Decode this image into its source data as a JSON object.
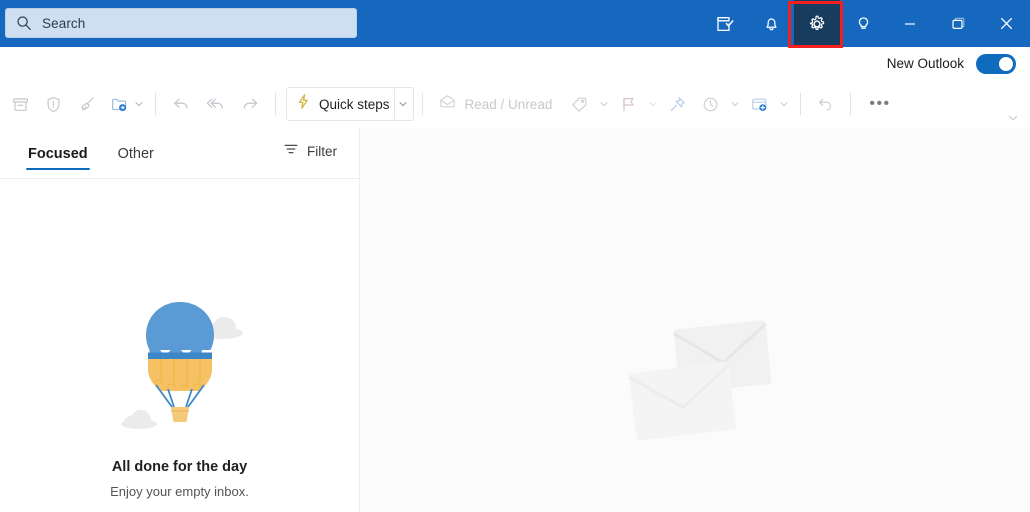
{
  "titlebar": {
    "search": {
      "placeholder": "Search",
      "value": "",
      "icon": "search-icon"
    },
    "buttons": [
      {
        "name": "task-compose-icon",
        "title": "New note"
      },
      {
        "name": "notifications-bell-icon",
        "title": "Notifications"
      },
      {
        "name": "settings-gear-icon",
        "title": "Settings",
        "highlighted": true
      },
      {
        "name": "tips-lightbulb-icon",
        "title": "Tips"
      }
    ],
    "window_controls": [
      {
        "name": "minimize-icon",
        "title": "Minimize"
      },
      {
        "name": "restore-icon",
        "title": "Restore"
      },
      {
        "name": "close-icon",
        "title": "Close"
      }
    ],
    "colors": {
      "background": "#1568bd",
      "search_background": "#cddff0",
      "highlight_border": "#f42020",
      "gear_active_background": "#173c5e"
    }
  },
  "new_outlook": {
    "label": "New Outlook",
    "toggle_on": true,
    "accent": "#0f6cbd"
  },
  "ribbon": {
    "items": [
      {
        "name": "archive-button",
        "icon": "archive-icon",
        "label": "",
        "enabled": false
      },
      {
        "name": "report-button",
        "icon": "shield-exclamation-icon",
        "label": "",
        "enabled": false
      },
      {
        "name": "sweep-button",
        "icon": "broom-icon",
        "label": "",
        "enabled": false
      },
      {
        "name": "move-to-button",
        "icon": "folder-arrow-icon",
        "label": "",
        "enabled": true,
        "has_caret": true
      },
      {
        "name": "reply-button",
        "icon": "reply-arrow-icon",
        "label": "",
        "enabled": false
      },
      {
        "name": "reply-all-button",
        "icon": "reply-all-arrow-icon",
        "label": "",
        "enabled": false
      },
      {
        "name": "forward-button",
        "icon": "forward-arrow-icon",
        "label": "",
        "enabled": false
      }
    ],
    "quick_steps": {
      "label": "Quick steps",
      "icon": "lightning-bolt-icon",
      "has_caret": true
    },
    "read_unread": {
      "label": "Read / Unread",
      "icon": "open-envelope-icon",
      "enabled": false
    },
    "trailing_items": [
      {
        "name": "categorize-button",
        "icon": "tag-icon",
        "has_caret": true
      },
      {
        "name": "flag-button",
        "icon": "flag-icon",
        "has_caret": true
      },
      {
        "name": "pin-button",
        "icon": "pin-icon",
        "has_caret": false
      },
      {
        "name": "snooze-button",
        "icon": "clock-icon",
        "has_caret": true
      },
      {
        "name": "rules-button",
        "icon": "rules-icon",
        "has_caret": true
      },
      {
        "name": "undo-button",
        "icon": "undo-arrow-icon",
        "has_caret": false
      }
    ],
    "overflow_label": "•••",
    "expand_icon": "chevron-down-icon"
  },
  "message_list": {
    "tabs": [
      {
        "label": "Focused",
        "active": true
      },
      {
        "label": "Other",
        "active": false
      }
    ],
    "filter": {
      "label": "Filter",
      "icon": "filter-icon"
    },
    "empty_state": {
      "illustration": "hot-air-balloon-illustration",
      "title": "All done for the day",
      "subtitle": "Enjoy your empty inbox.",
      "colors": {
        "balloon_top": "#5b9bd5",
        "balloon_band": "#f5c163",
        "basket": "#f5c97a",
        "cloud": "#e8e8e8"
      }
    }
  },
  "reading_pane": {
    "watermark": "two-envelopes-watermark",
    "background": "#fbfbfb"
  }
}
